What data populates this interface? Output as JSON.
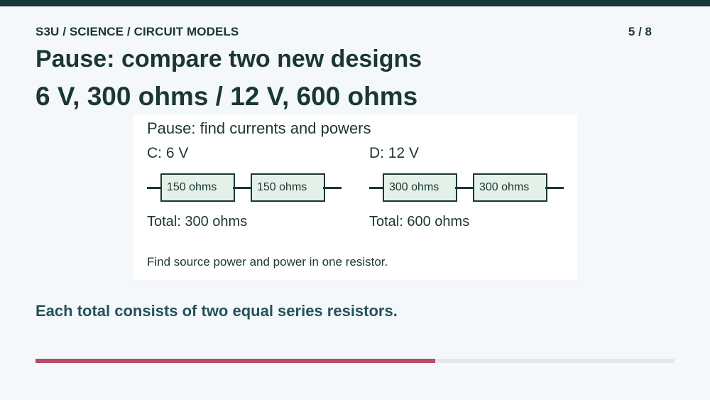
{
  "header": {
    "breadcrumb": "S3U / SCIENCE / CIRCUIT MODELS",
    "page_indicator": "5 / 8",
    "title": "Pause: compare two new designs",
    "subtitle": "6 V, 300 ohms / 12 V, 600 ohms"
  },
  "card": {
    "title": "Pause: find currents and powers",
    "circuits": [
      {
        "label": "C: 6 V",
        "resistors": [
          "150 ohms",
          "150 ohms"
        ],
        "total": "Total: 300 ohms"
      },
      {
        "label": "D: 12 V",
        "resistors": [
          "300 ohms",
          "300 ohms"
        ],
        "total": "Total: 600 ohms"
      }
    ],
    "note": "Find source power and power in one resistor."
  },
  "summary": "Each total consists of two equal series resistors.",
  "progress": {
    "fraction": 0.625,
    "fill_color": "#b84c64",
    "track_color": "#e2e8ec"
  },
  "colors": {
    "accent": "#163a3a",
    "resistor_fill": "#e3f1e8",
    "text": "#1b3634"
  }
}
